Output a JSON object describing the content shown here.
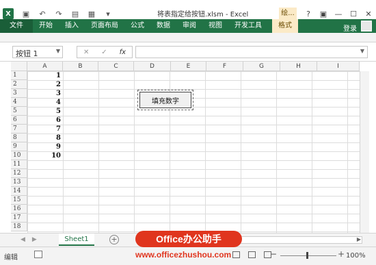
{
  "window": {
    "title": "将表指定给按钮.xlsm - Excel",
    "contextual_tab_group": "绘...",
    "help": "?",
    "ribbon_display": "▣",
    "minimize": "—",
    "restore": "☐",
    "close": "✕"
  },
  "qat": {
    "app_icon": "X",
    "save": "▣",
    "undo": "↶",
    "redo": "↷",
    "extra1": "▤",
    "extra2": "▦",
    "customize": "▾"
  },
  "tabs": [
    {
      "label": "文件"
    },
    {
      "label": "开始"
    },
    {
      "label": "插入"
    },
    {
      "label": "页面布局"
    },
    {
      "label": "公式"
    },
    {
      "label": "数据"
    },
    {
      "label": "审阅"
    },
    {
      "label": "视图"
    },
    {
      "label": "开发工具"
    },
    {
      "label": "格式"
    }
  ],
  "account": {
    "login": "登录"
  },
  "formula_bar": {
    "name_box": "按钮 1",
    "cancel": "✕",
    "enter": "✓",
    "fx": "fx",
    "value": ""
  },
  "columns": [
    "A",
    "B",
    "C",
    "D",
    "E",
    "F",
    "G",
    "H",
    "I"
  ],
  "rows": [
    "1",
    "2",
    "3",
    "4",
    "5",
    "6",
    "7",
    "8",
    "9",
    "10",
    "11",
    "12",
    "13",
    "14",
    "15",
    "16",
    "17",
    "18"
  ],
  "column_a_values": [
    "1",
    "2",
    "3",
    "4",
    "5",
    "6",
    "7",
    "8",
    "9",
    "10"
  ],
  "form_button": {
    "label": "填充数字"
  },
  "sheets": {
    "active": "Sheet1",
    "add": "+"
  },
  "status": {
    "mode": "编辑",
    "zoom": "100%",
    "zoom_minus": "−",
    "zoom_plus": "+"
  },
  "watermark": {
    "badge": "Office办公助手",
    "url": "www.officezhushou.com"
  }
}
